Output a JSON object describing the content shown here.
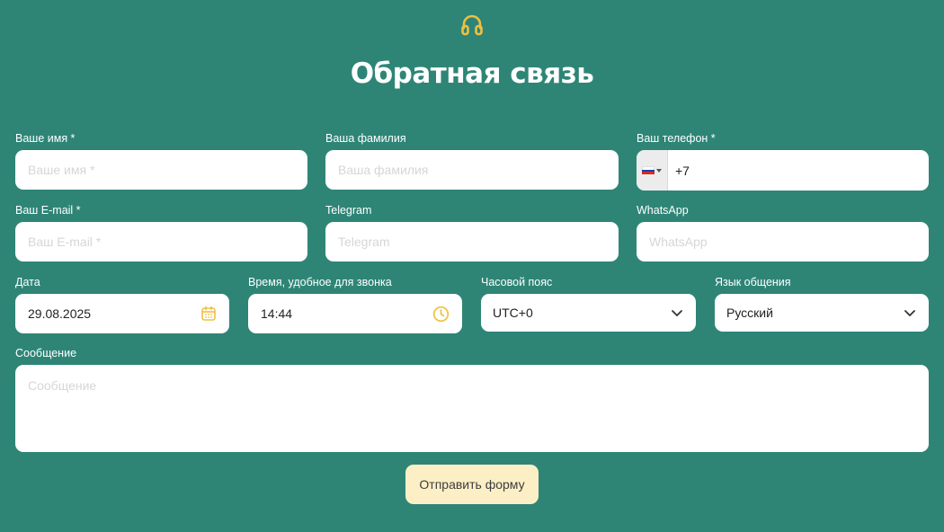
{
  "header": {
    "icon": "headset-icon",
    "title": "Обратная связь"
  },
  "colors": {
    "background": "#2e8576",
    "accent": "#f0c040",
    "submit_bg": "#fcefc5"
  },
  "fields": {
    "first_name": {
      "label": "Ваше имя *",
      "placeholder": "Ваше имя *",
      "value": ""
    },
    "last_name": {
      "label": "Ваша фамилия",
      "placeholder": "Ваша фамилия",
      "value": ""
    },
    "phone": {
      "label": "Ваш телефон *",
      "country": "RU",
      "flag_icon": "russia-flag-icon",
      "value": "+7"
    },
    "email": {
      "label": "Ваш E-mail *",
      "placeholder": "Ваш E-mail *",
      "value": ""
    },
    "telegram": {
      "label": "Telegram",
      "placeholder": "Telegram",
      "value": ""
    },
    "whatsapp": {
      "label": "WhatsApp",
      "placeholder": "WhatsApp",
      "value": ""
    },
    "date": {
      "label": "Дата",
      "value": "29.08.2025",
      "icon": "calendar-icon"
    },
    "time": {
      "label": "Время, удобное для звонка",
      "value": "14:44",
      "icon": "clock-icon"
    },
    "timezone": {
      "label": "Часовой пояс",
      "value": "UTC+0",
      "icon": "chevron-down-icon"
    },
    "language": {
      "label": "Язык общения",
      "value": "Русский",
      "icon": "chevron-down-icon"
    },
    "message": {
      "label": "Сообщение",
      "placeholder": "Сообщение",
      "value": ""
    }
  },
  "submit": {
    "label": "Отправить форму"
  }
}
